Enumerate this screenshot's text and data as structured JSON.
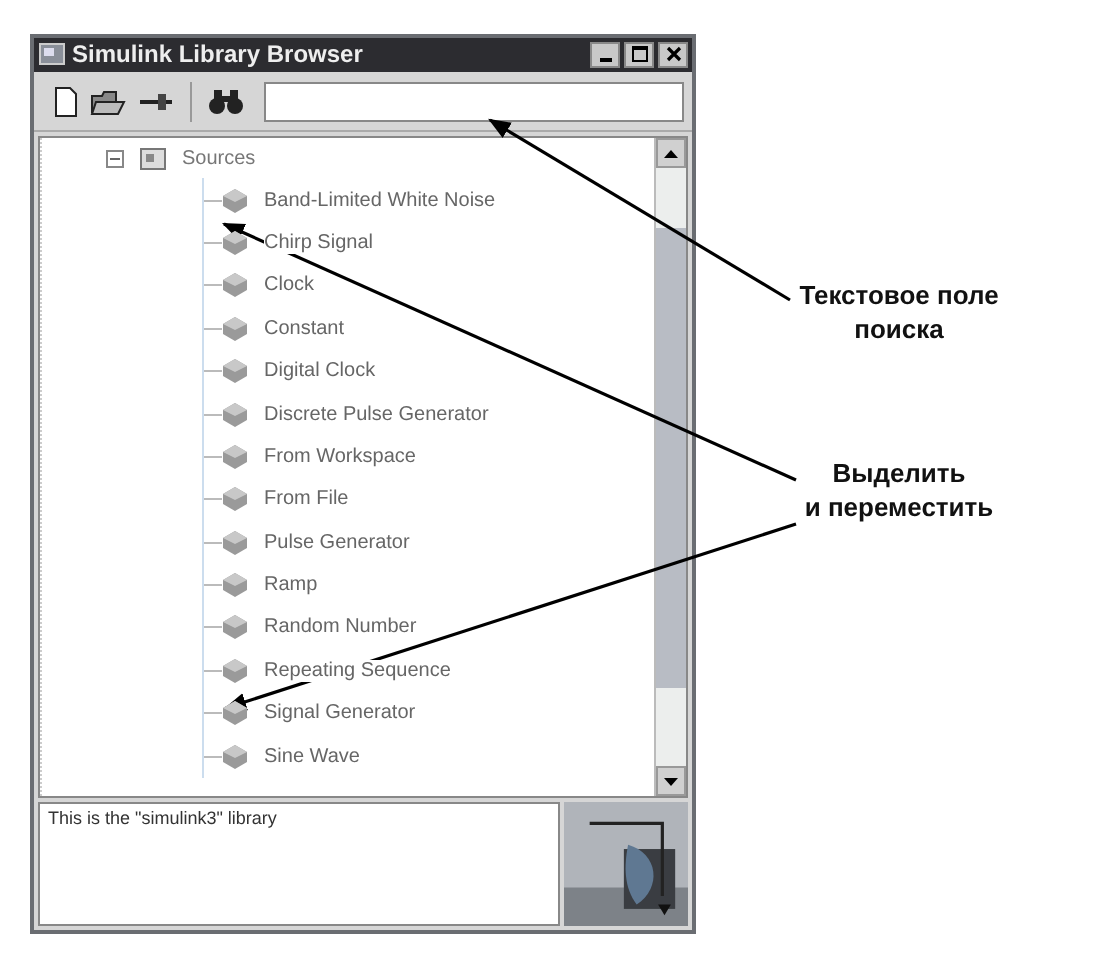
{
  "window": {
    "title": "Simulink Library Browser"
  },
  "tree": [
    {
      "label": "Sources",
      "expanded": true,
      "children": [
        {
          "label": "Band-Limited White Noise"
        },
        {
          "label": "Chirp Signal"
        },
        {
          "label": "Clock"
        },
        {
          "label": "Constant"
        },
        {
          "label": "Digital Clock"
        },
        {
          "label": "Discrete Pulse Generator"
        },
        {
          "label": "From Workspace"
        },
        {
          "label": "From File"
        },
        {
          "label": "Pulse Generator"
        },
        {
          "label": "Ramp"
        },
        {
          "label": "Random Number"
        },
        {
          "label": "Repeating Sequence"
        },
        {
          "label": "Signal Generator"
        },
        {
          "label": "Sine Wave"
        }
      ]
    }
  ],
  "description": "This is the \"simulink3\" library",
  "annotations": [
    {
      "text": "Текстовое поле\nпоиска"
    },
    {
      "text": "Выделить\nи переместить"
    }
  ]
}
